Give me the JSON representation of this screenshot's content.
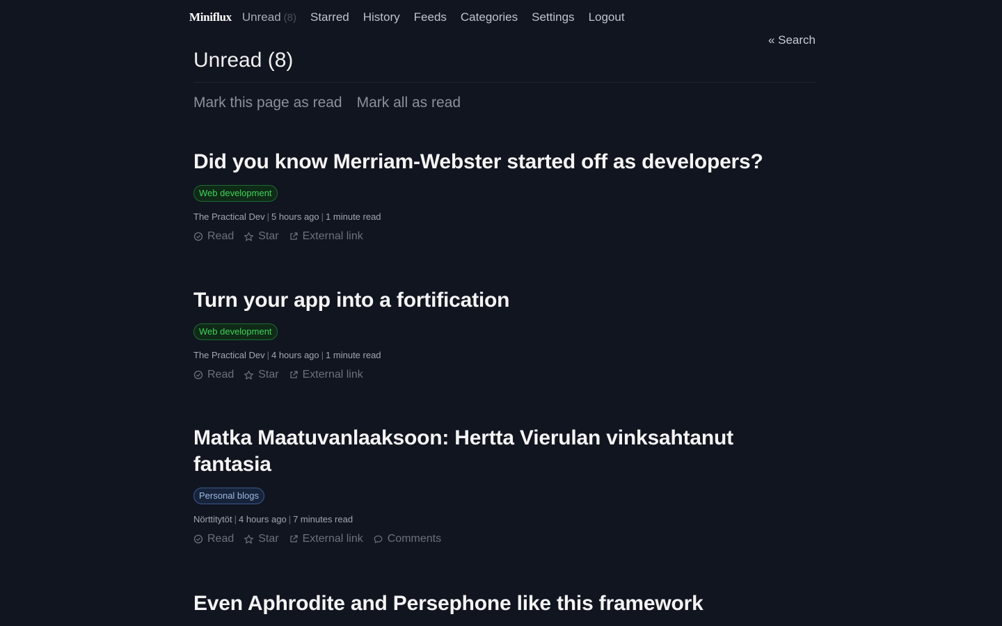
{
  "nav": {
    "logo": "Miniflux",
    "unread_label": "Unread",
    "unread_count": "(8)",
    "starred": "Starred",
    "history": "History",
    "feeds": "Feeds",
    "categories": "Categories",
    "settings": "Settings",
    "logout": "Logout"
  },
  "search_link": "« Search",
  "page_title": "Unread (8)",
  "page_actions": {
    "mark_page": "Mark this page as read",
    "mark_all": "Mark all as read"
  },
  "entry_actions": {
    "read": "Read",
    "star": "Star",
    "external": "External link",
    "comments": "Comments"
  },
  "entries": [
    {
      "title": "Did you know Merriam-Webster started off as developers?",
      "category": "Web development",
      "feed": "The Practical Dev",
      "time": "5 hours ago",
      "reading_time": "1 minute read"
    },
    {
      "title": "Turn your app into a fortification",
      "category": "Web development",
      "feed": "The Practical Dev",
      "time": "4 hours ago",
      "reading_time": "1 minute read"
    },
    {
      "title": "Matka Maatuvanlaaksoon: Hertta Vierulan vinksahtanut fantasia",
      "category": "Personal blogs",
      "feed": "Nörttitytöt",
      "time": "4 hours ago",
      "reading_time": "7 minutes read"
    },
    {
      "title": "Even Aphrodite and Persephone like this framework"
    }
  ]
}
